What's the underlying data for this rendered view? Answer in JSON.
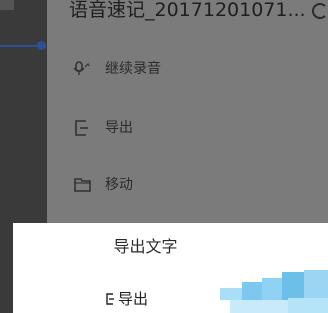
{
  "menu": {
    "title": "语音速记_20171201071...",
    "items": [
      {
        "label": "继续录音",
        "icon": "microphone-icon"
      },
      {
        "label": "导出",
        "icon": "export-icon"
      },
      {
        "label": "移动",
        "icon": "folder-icon"
      }
    ]
  },
  "dialog": {
    "title": "导出文字",
    "option_label": "导出",
    "option_icon": "export-icon"
  },
  "colors": {
    "overlay": "#7b7b7b",
    "background": "#2a2a2a",
    "accent": "#2c4f9a",
    "dialog_bg": "#ffffff",
    "blur_blue": "#7cc8ef"
  }
}
